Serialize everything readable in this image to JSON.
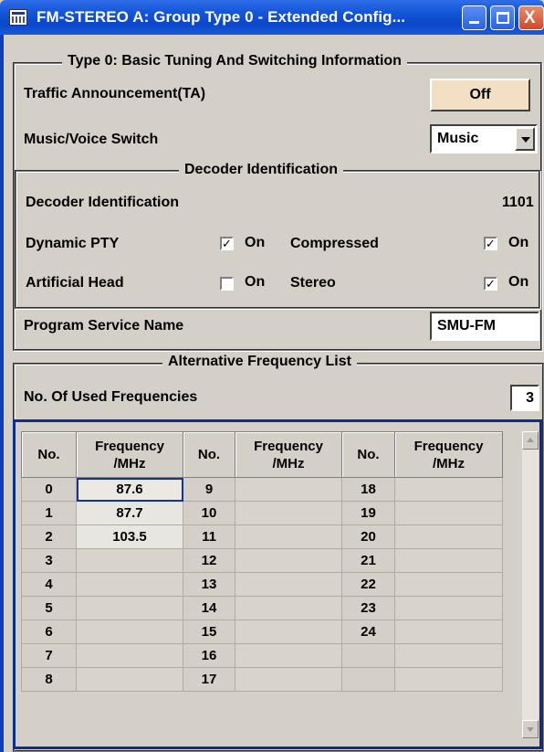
{
  "window": {
    "title": "FM-STEREO A: Group Type 0 - Extended Config...",
    "close_glyph": "X"
  },
  "basic": {
    "group_title": "Type 0: Basic Tuning And Switching Information",
    "ta_label": "Traffic Announcement(TA)",
    "ta_value": "Off",
    "mv_label": "Music/Voice Switch",
    "mv_value": "Music"
  },
  "decoder": {
    "group_title": "Decoder Identification",
    "id_label": "Decoder Identification",
    "id_value": "1101",
    "dynamic_pty_label": "Dynamic PTY",
    "dynamic_pty_checked": true,
    "compressed_label": "Compressed",
    "compressed_checked": true,
    "artificial_head_label": "Artificial Head",
    "artificial_head_checked": false,
    "stereo_label": "Stereo",
    "stereo_checked": true,
    "on_label": "On",
    "check_glyph": "✓"
  },
  "psn": {
    "label": "Program Service Name",
    "value": "SMU-FM"
  },
  "af": {
    "group_title": "Alternative Frequency List",
    "used_label": "No. Of Used Frequencies",
    "used_value": "3",
    "col_no": "No.",
    "col_freq_line1": "Frequency",
    "col_freq_line2": "/MHz",
    "rows": [
      {
        "no1": "0",
        "f1": "87.6",
        "no2": "9",
        "f2": "",
        "no3": "18",
        "f3": ""
      },
      {
        "no1": "1",
        "f1": "87.7",
        "no2": "10",
        "f2": "",
        "no3": "19",
        "f3": ""
      },
      {
        "no1": "2",
        "f1": "103.5",
        "no2": "11",
        "f2": "",
        "no3": "20",
        "f3": ""
      },
      {
        "no1": "3",
        "f1": "",
        "no2": "12",
        "f2": "",
        "no3": "21",
        "f3": ""
      },
      {
        "no1": "4",
        "f1": "",
        "no2": "13",
        "f2": "",
        "no3": "22",
        "f3": ""
      },
      {
        "no1": "5",
        "f1": "",
        "no2": "14",
        "f2": "",
        "no3": "23",
        "f3": ""
      },
      {
        "no1": "6",
        "f1": "",
        "no2": "15",
        "f2": "",
        "no3": "24",
        "f3": ""
      },
      {
        "no1": "7",
        "f1": "",
        "no2": "16",
        "f2": "",
        "no3": "",
        "f3": ""
      },
      {
        "no1": "8",
        "f1": "",
        "no2": "17",
        "f2": "",
        "no3": "",
        "f3": ""
      }
    ]
  },
  "colors": {
    "titlebar": "#1556d9",
    "button_off_bg": "#f2dfc4",
    "table_frame": "#0f2c8f",
    "panel_bg": "#d4d0c8"
  }
}
